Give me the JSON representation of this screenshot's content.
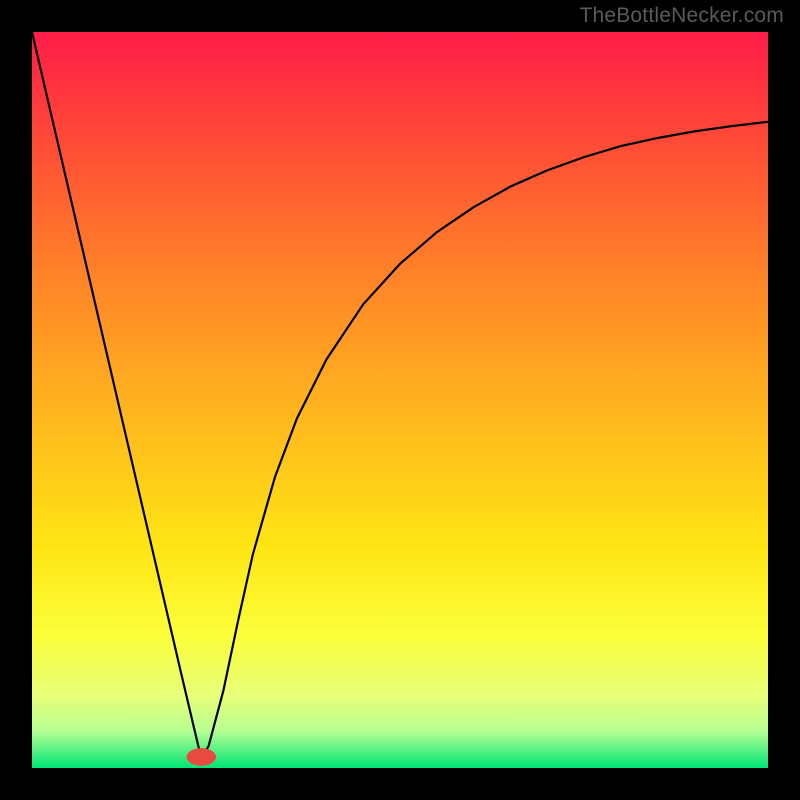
{
  "watermark": "TheBottleNecker.com",
  "chart_data": {
    "type": "line",
    "title": "",
    "xlabel": "",
    "ylabel": "",
    "xlim": [
      0,
      100
    ],
    "ylim": [
      0,
      100
    ],
    "background_gradient": {
      "stops": [
        {
          "offset": 0.0,
          "color": "#ff1d49"
        },
        {
          "offset": 0.1,
          "color": "#ff3b3b"
        },
        {
          "offset": 0.3,
          "color": "#ff7a2a"
        },
        {
          "offset": 0.5,
          "color": "#ffb11f"
        },
        {
          "offset": 0.7,
          "color": "#ffe514"
        },
        {
          "offset": 0.82,
          "color": "#fbff3a"
        },
        {
          "offset": 0.9,
          "color": "#e8ff78"
        },
        {
          "offset": 0.95,
          "color": "#b6ff92"
        },
        {
          "offset": 1.0,
          "color": "#00e676"
        }
      ]
    },
    "marker": {
      "x": 23.0,
      "y": 1.5,
      "rx": 2.0,
      "ry": 1.2,
      "color": "#e84a3f"
    },
    "series": [
      {
        "name": "curve",
        "x": [
          0,
          5,
          10,
          15,
          20,
          22,
          23,
          24,
          26,
          28,
          30,
          33,
          36,
          40,
          45,
          50,
          55,
          60,
          65,
          70,
          75,
          80,
          85,
          90,
          95,
          100
        ],
        "y": [
          100,
          78.5,
          57.0,
          35.5,
          14.0,
          5.5,
          1.3,
          3.0,
          10.5,
          20.0,
          29.0,
          39.5,
          47.5,
          55.5,
          63.0,
          68.5,
          72.8,
          76.2,
          79.0,
          81.2,
          83.0,
          84.5,
          85.6,
          86.5,
          87.2,
          87.8
        ]
      }
    ]
  }
}
